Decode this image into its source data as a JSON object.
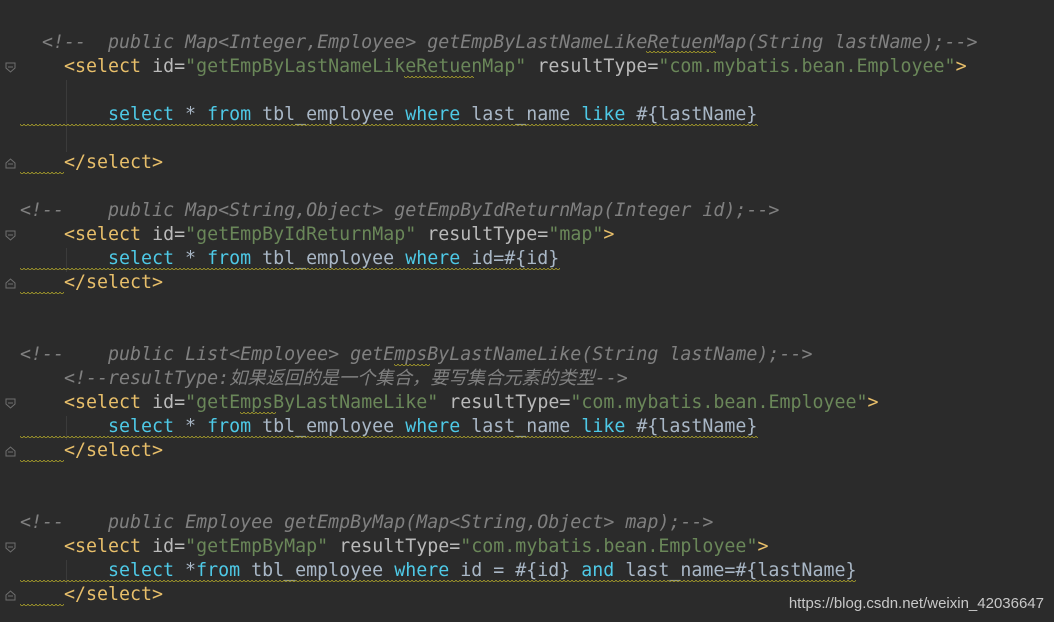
{
  "lines": [
    {
      "id": "l1",
      "parts": [
        {
          "cls": "c-comment",
          "t": "<!--  public Map<Integer,Employee> getEmpByLastNameLikeRetuenMap(String lastName);-->"
        }
      ]
    },
    {
      "id": "l2",
      "parts": [
        {
          "cls": "c-tag",
          "t": "<select "
        },
        {
          "cls": "c-attr",
          "t": "id="
        },
        {
          "cls": "c-val",
          "t": "\"getEmpByLastNameLikeRetuenMap\""
        },
        {
          "cls": "c-plain",
          "t": " "
        },
        {
          "cls": "c-attr",
          "t": "resultType="
        },
        {
          "cls": "c-val",
          "t": "\"com.mybatis.bean.Employee\""
        },
        {
          "cls": "c-tag",
          "t": ">"
        }
      ]
    },
    {
      "id": "l3",
      "parts": [
        {
          "cls": "c-sql",
          "t": "select"
        },
        {
          "cls": "c-plain",
          "t": " * "
        },
        {
          "cls": "c-sql",
          "t": "from"
        },
        {
          "cls": "c-plain",
          "t": " tbl_employee "
        },
        {
          "cls": "c-sql",
          "t": "where"
        },
        {
          "cls": "c-plain",
          "t": " last_name "
        },
        {
          "cls": "c-sql",
          "t": "like"
        },
        {
          "cls": "c-plain",
          "t": " #{lastName}"
        }
      ]
    },
    {
      "id": "l4",
      "parts": [
        {
          "cls": "c-tag",
          "t": "</select>"
        }
      ]
    },
    {
      "id": "l5",
      "parts": [
        {
          "cls": "c-comment",
          "t": "<!--    public Map<String,Object> getEmpByIdReturnMap(Integer id);-->"
        }
      ]
    },
    {
      "id": "l6",
      "parts": [
        {
          "cls": "c-tag",
          "t": "<select "
        },
        {
          "cls": "c-attr",
          "t": "id="
        },
        {
          "cls": "c-val",
          "t": "\"getEmpByIdReturnMap\""
        },
        {
          "cls": "c-plain",
          "t": " "
        },
        {
          "cls": "c-attr",
          "t": "resultType="
        },
        {
          "cls": "c-val",
          "t": "\"map\""
        },
        {
          "cls": "c-tag",
          "t": ">"
        }
      ]
    },
    {
      "id": "l7",
      "parts": [
        {
          "cls": "c-sql",
          "t": "select"
        },
        {
          "cls": "c-plain",
          "t": " * "
        },
        {
          "cls": "c-sql",
          "t": "from"
        },
        {
          "cls": "c-plain",
          "t": " tbl_employee "
        },
        {
          "cls": "c-sql",
          "t": "where"
        },
        {
          "cls": "c-plain",
          "t": " id=#{id}"
        }
      ]
    },
    {
      "id": "l8",
      "parts": [
        {
          "cls": "c-tag",
          "t": "</select>"
        }
      ]
    },
    {
      "id": "l9",
      "parts": [
        {
          "cls": "c-comment",
          "t": "<!--    public List<Employee> getEmpsByLastNameLike(String lastName);-->"
        }
      ]
    },
    {
      "id": "l10",
      "parts": [
        {
          "cls": "c-comment",
          "t": "<!--resultType:"
        },
        {
          "cls": "c-cjk",
          "t": "如果返回的是一个集合，要写集合元素的类型"
        },
        {
          "cls": "c-comment",
          "t": "-->"
        }
      ]
    },
    {
      "id": "l11",
      "parts": [
        {
          "cls": "c-tag",
          "t": "<select "
        },
        {
          "cls": "c-attr",
          "t": "id="
        },
        {
          "cls": "c-val",
          "t": "\"getEmpsByLastNameLike\""
        },
        {
          "cls": "c-plain",
          "t": " "
        },
        {
          "cls": "c-attr",
          "t": "resultType="
        },
        {
          "cls": "c-val",
          "t": "\"com.mybatis.bean.Employee\""
        },
        {
          "cls": "c-tag",
          "t": ">"
        }
      ]
    },
    {
      "id": "l12",
      "parts": [
        {
          "cls": "c-sql",
          "t": "select"
        },
        {
          "cls": "c-plain",
          "t": " * "
        },
        {
          "cls": "c-sql",
          "t": "from"
        },
        {
          "cls": "c-plain",
          "t": " tbl_employee "
        },
        {
          "cls": "c-sql",
          "t": "where"
        },
        {
          "cls": "c-plain",
          "t": " last_name "
        },
        {
          "cls": "c-sql",
          "t": "like"
        },
        {
          "cls": "c-plain",
          "t": " #{lastName}"
        }
      ]
    },
    {
      "id": "l13",
      "parts": [
        {
          "cls": "c-tag",
          "t": "</select>"
        }
      ]
    },
    {
      "id": "l14",
      "parts": [
        {
          "cls": "c-comment",
          "t": "<!--    public Employee getEmpByMap(Map<String,Object> map);-->"
        }
      ]
    },
    {
      "id": "l15",
      "parts": [
        {
          "cls": "c-tag",
          "t": "<select "
        },
        {
          "cls": "c-attr",
          "t": "id="
        },
        {
          "cls": "c-val",
          "t": "\"getEmpByMap\""
        },
        {
          "cls": "c-plain",
          "t": " "
        },
        {
          "cls": "c-attr",
          "t": "resultType="
        },
        {
          "cls": "c-val",
          "t": "\"com.mybatis.bean.Employee\""
        },
        {
          "cls": "c-tag",
          "t": ">"
        }
      ]
    },
    {
      "id": "l16",
      "parts": [
        {
          "cls": "c-sql",
          "t": "select"
        },
        {
          "cls": "c-plain",
          "t": " *"
        },
        {
          "cls": "c-sql",
          "t": "from"
        },
        {
          "cls": "c-plain",
          "t": " tbl_employee "
        },
        {
          "cls": "c-sql",
          "t": "where"
        },
        {
          "cls": "c-plain",
          "t": " id = #{id} "
        },
        {
          "cls": "c-sql",
          "t": "and"
        },
        {
          "cls": "c-plain",
          "t": " last_name=#{lastName}"
        }
      ]
    },
    {
      "id": "l17",
      "parts": [
        {
          "cls": "c-tag",
          "t": "</select>"
        }
      ]
    }
  ],
  "watermark": "https://blog.csdn.net/weixin_42036647",
  "colors": {
    "background": "#2b2b2b",
    "xml_tag": "#e8bf6a",
    "attr_value": "#6a8759",
    "sql_keyword": "#4ec9e6",
    "comment": "#808080",
    "text": "#a9b7c6"
  }
}
